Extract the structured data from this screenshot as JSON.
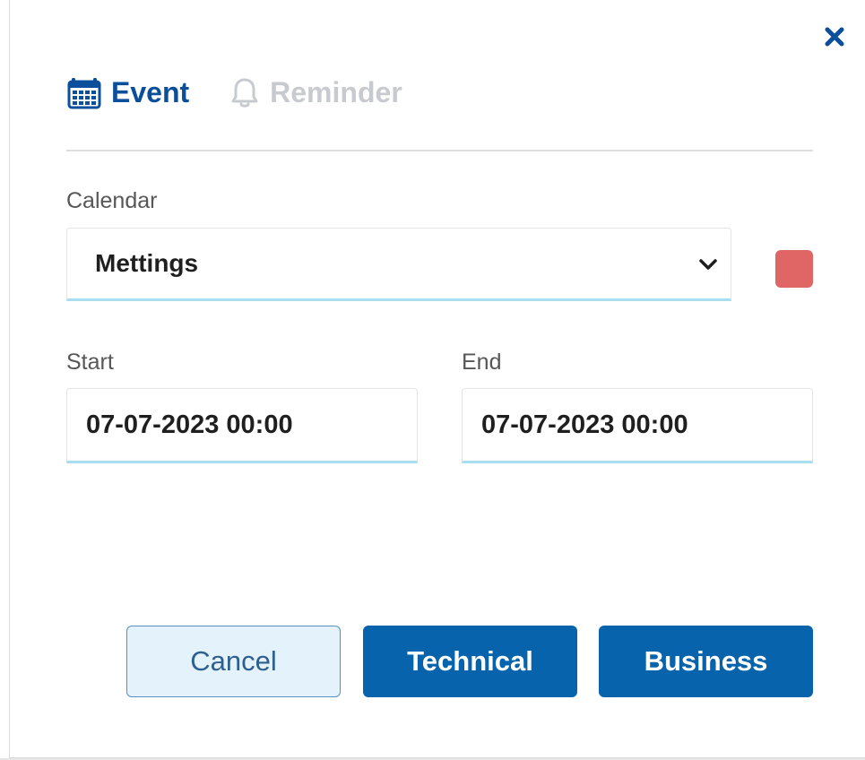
{
  "tabs": [
    {
      "label": "Event",
      "icon": "calendar-icon",
      "active": true
    },
    {
      "label": "Reminder",
      "icon": "bell-icon",
      "active": false
    }
  ],
  "calendar": {
    "label": "Calendar",
    "selected": "Mettings",
    "color": "#e06666"
  },
  "start": {
    "label": "Start",
    "value": "07-07-2023 00:00"
  },
  "end": {
    "label": "End",
    "value": "07-07-2023 00:00"
  },
  "buttons": {
    "cancel": "Cancel",
    "technical": "Technical",
    "business": "Business"
  },
  "colors": {
    "accent": "#0863ad",
    "tab_active": "#0b4f9c",
    "tab_inactive": "#c7cbcf",
    "field_underline": "#a9ddf0"
  }
}
